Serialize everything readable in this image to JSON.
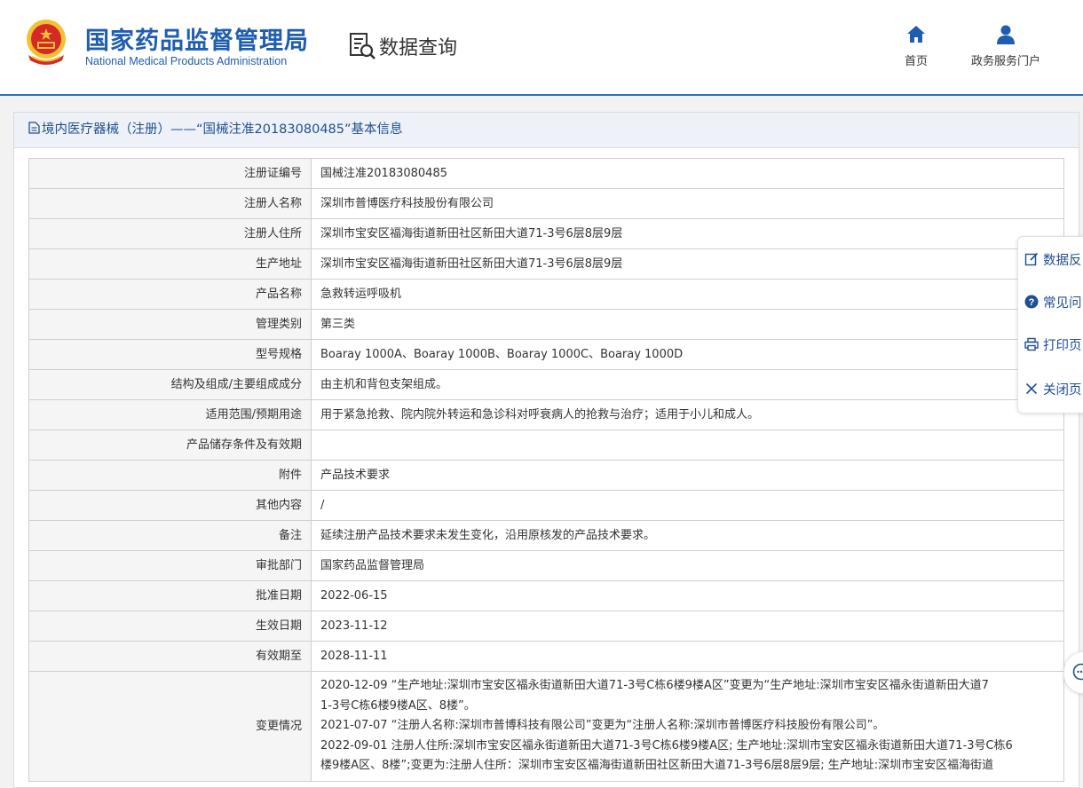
{
  "header": {
    "org_name_cn": "国家药品监督管理局",
    "org_name_en": "National Medical Products Administration",
    "section_title": "数据查询",
    "nav": {
      "home": "首页",
      "portal": "政务服务门户"
    }
  },
  "panel": {
    "title": "境内医疗器械（注册）——“国械注准20183080485”基本信息"
  },
  "rows": [
    {
      "label": "注册证编号",
      "value": "国械注准20183080485"
    },
    {
      "label": "注册人名称",
      "value": "深圳市普博医疗科技股份有限公司"
    },
    {
      "label": "注册人住所",
      "value": "深圳市宝安区福海街道新田社区新田大道71-3号6层8层9层"
    },
    {
      "label": "生产地址",
      "value": "深圳市宝安区福海街道新田社区新田大道71-3号6层8层9层"
    },
    {
      "label": "产品名称",
      "value": "急救转运呼吸机"
    },
    {
      "label": "管理类别",
      "value": "第三类"
    },
    {
      "label": "型号规格",
      "value": "Boaray 1000A、Boaray 1000B、Boaray 1000C、Boaray 1000D"
    },
    {
      "label": "结构及组成/主要组成成分",
      "value": "由主机和背包支架组成。"
    },
    {
      "label": "适用范围/预期用途",
      "value": "用于紧急抢救、院内院外转运和急诊科对呼衰病人的抢救与治疗；适用于小儿和成人。"
    },
    {
      "label": "产品储存条件及有效期",
      "value": ""
    },
    {
      "label": "附件",
      "value": "产品技术要求"
    },
    {
      "label": "其他内容",
      "value": "/"
    },
    {
      "label": "备注",
      "value": "延续注册产品技术要求未发生变化，沿用原核发的产品技术要求。"
    },
    {
      "label": "审批部门",
      "value": "国家药品监督管理局"
    },
    {
      "label": "批准日期",
      "value": "2022-06-15"
    },
    {
      "label": "生效日期",
      "value": "2023-11-12"
    },
    {
      "label": "有效期至",
      "value": "2028-11-11"
    }
  ],
  "change": {
    "label": "变更情况",
    "lines": [
      "2020-12-09 “生产地址:深圳市宝安区福永街道新田大道71-3号C栋6楼9楼A区”变更为“生产地址:深圳市宝安区福永街道新田大道7",
      "1-3号C栋6楼9楼A区、8楼”。",
      "2021-07-07 “注册人名称:深圳市普博科技有限公司”变更为“注册人名称:深圳市普博医疗科技股份有限公司”。",
      "2022-09-01 注册人住所:深圳市宝安区福永街道新田大道71-3号C栋6楼9楼A区; 生产地址:深圳市宝安区福永街道新田大道71-3号C栋6",
      "楼9楼A区、8楼”;变更为:注册人住所：深圳市宝安区福海街道新田社区新田大道71-3号6层8层9层; 生产地址:深圳市宝安区福海街道"
    ]
  },
  "float_bar": {
    "feedback": "数据反",
    "faq": "常见问",
    "print": "打印页",
    "close": "关闭页"
  },
  "colors": {
    "brand_blue": "#1e5db0",
    "title_blue": "#1f4f91",
    "emblem_red": "#d62828",
    "emblem_gold": "#f2c230"
  },
  "icons": [
    "national-emblem-icon",
    "data-query-icon",
    "home-icon",
    "user-icon",
    "document-icon",
    "edit-icon",
    "question-icon",
    "printer-icon",
    "close-icon",
    "chat-icon"
  ]
}
